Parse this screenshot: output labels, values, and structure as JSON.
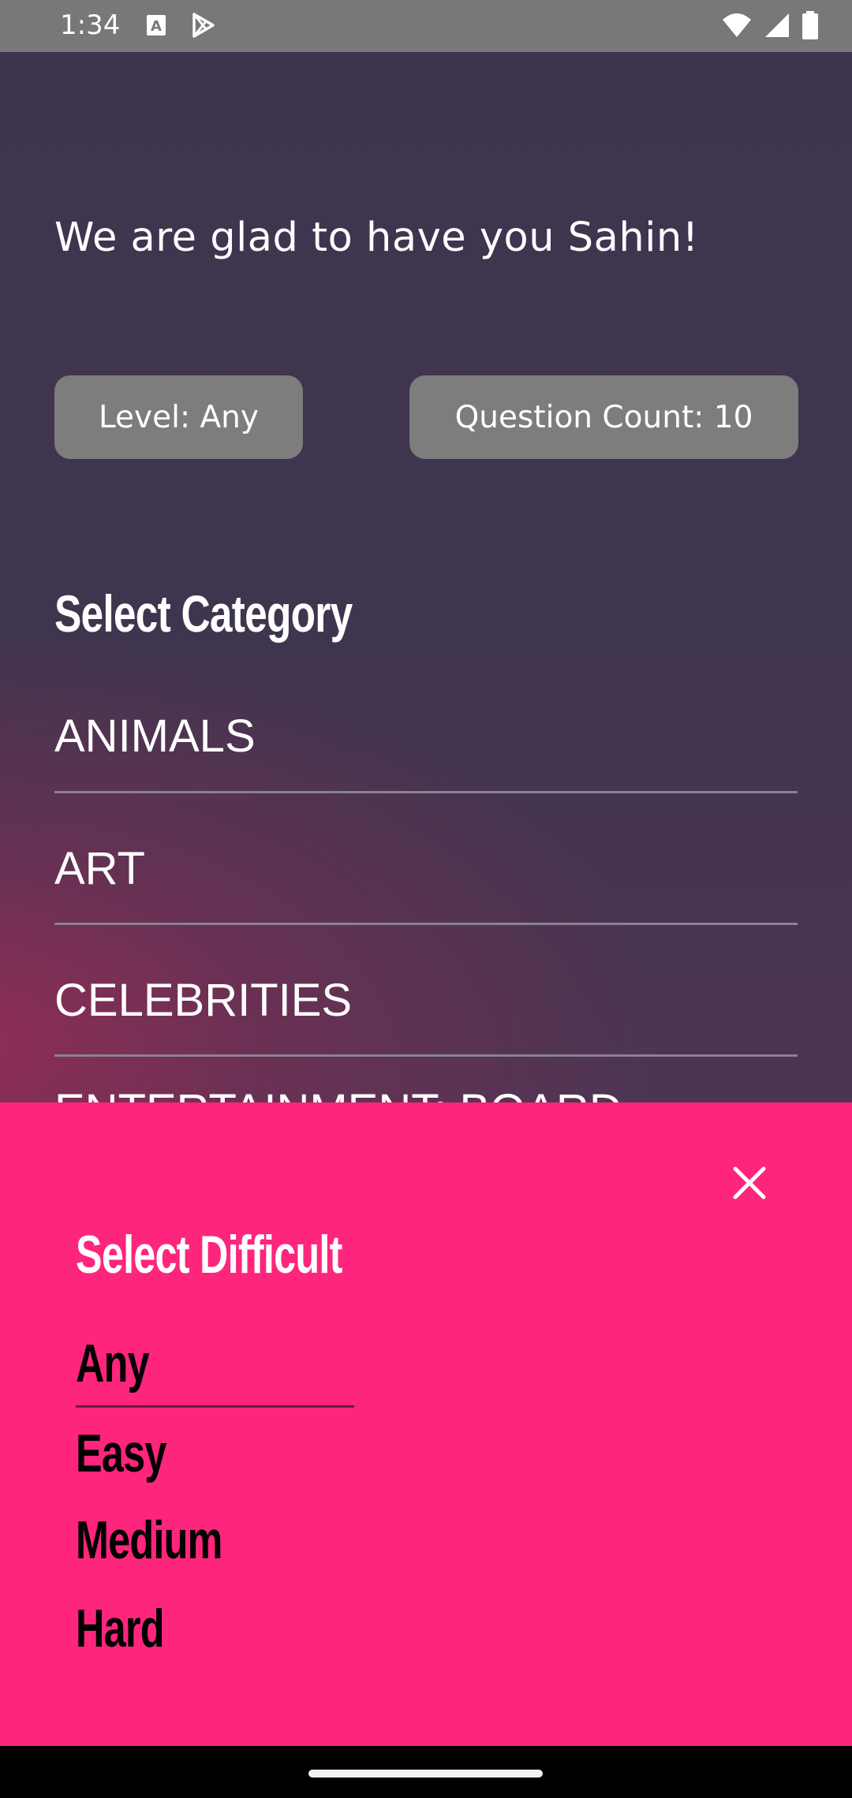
{
  "status_bar": {
    "time": "1:34",
    "icons": [
      "keyboard-a-icon",
      "play-store-icon",
      "wifi-icon",
      "signal-icon",
      "battery-icon"
    ]
  },
  "main": {
    "welcome": "We are glad to have you Sahin!",
    "level_button": "Level: Any",
    "count_button": "Question Count: 10",
    "section_title": "Select Category",
    "categories": [
      "ANIMALS",
      "ART",
      "CELEBRITIES",
      "ENTERTAINMENT: BOARD GAMES"
    ]
  },
  "sheet": {
    "title": "Select Difficult",
    "options": [
      "Any",
      "Easy",
      "Medium",
      "Hard"
    ],
    "selected": "Any",
    "close_icon": "close-icon"
  },
  "colors": {
    "sheet_bg": "#fe257d",
    "pill_bg": "#7d7d7d",
    "status_bar_bg": "#787878"
  }
}
